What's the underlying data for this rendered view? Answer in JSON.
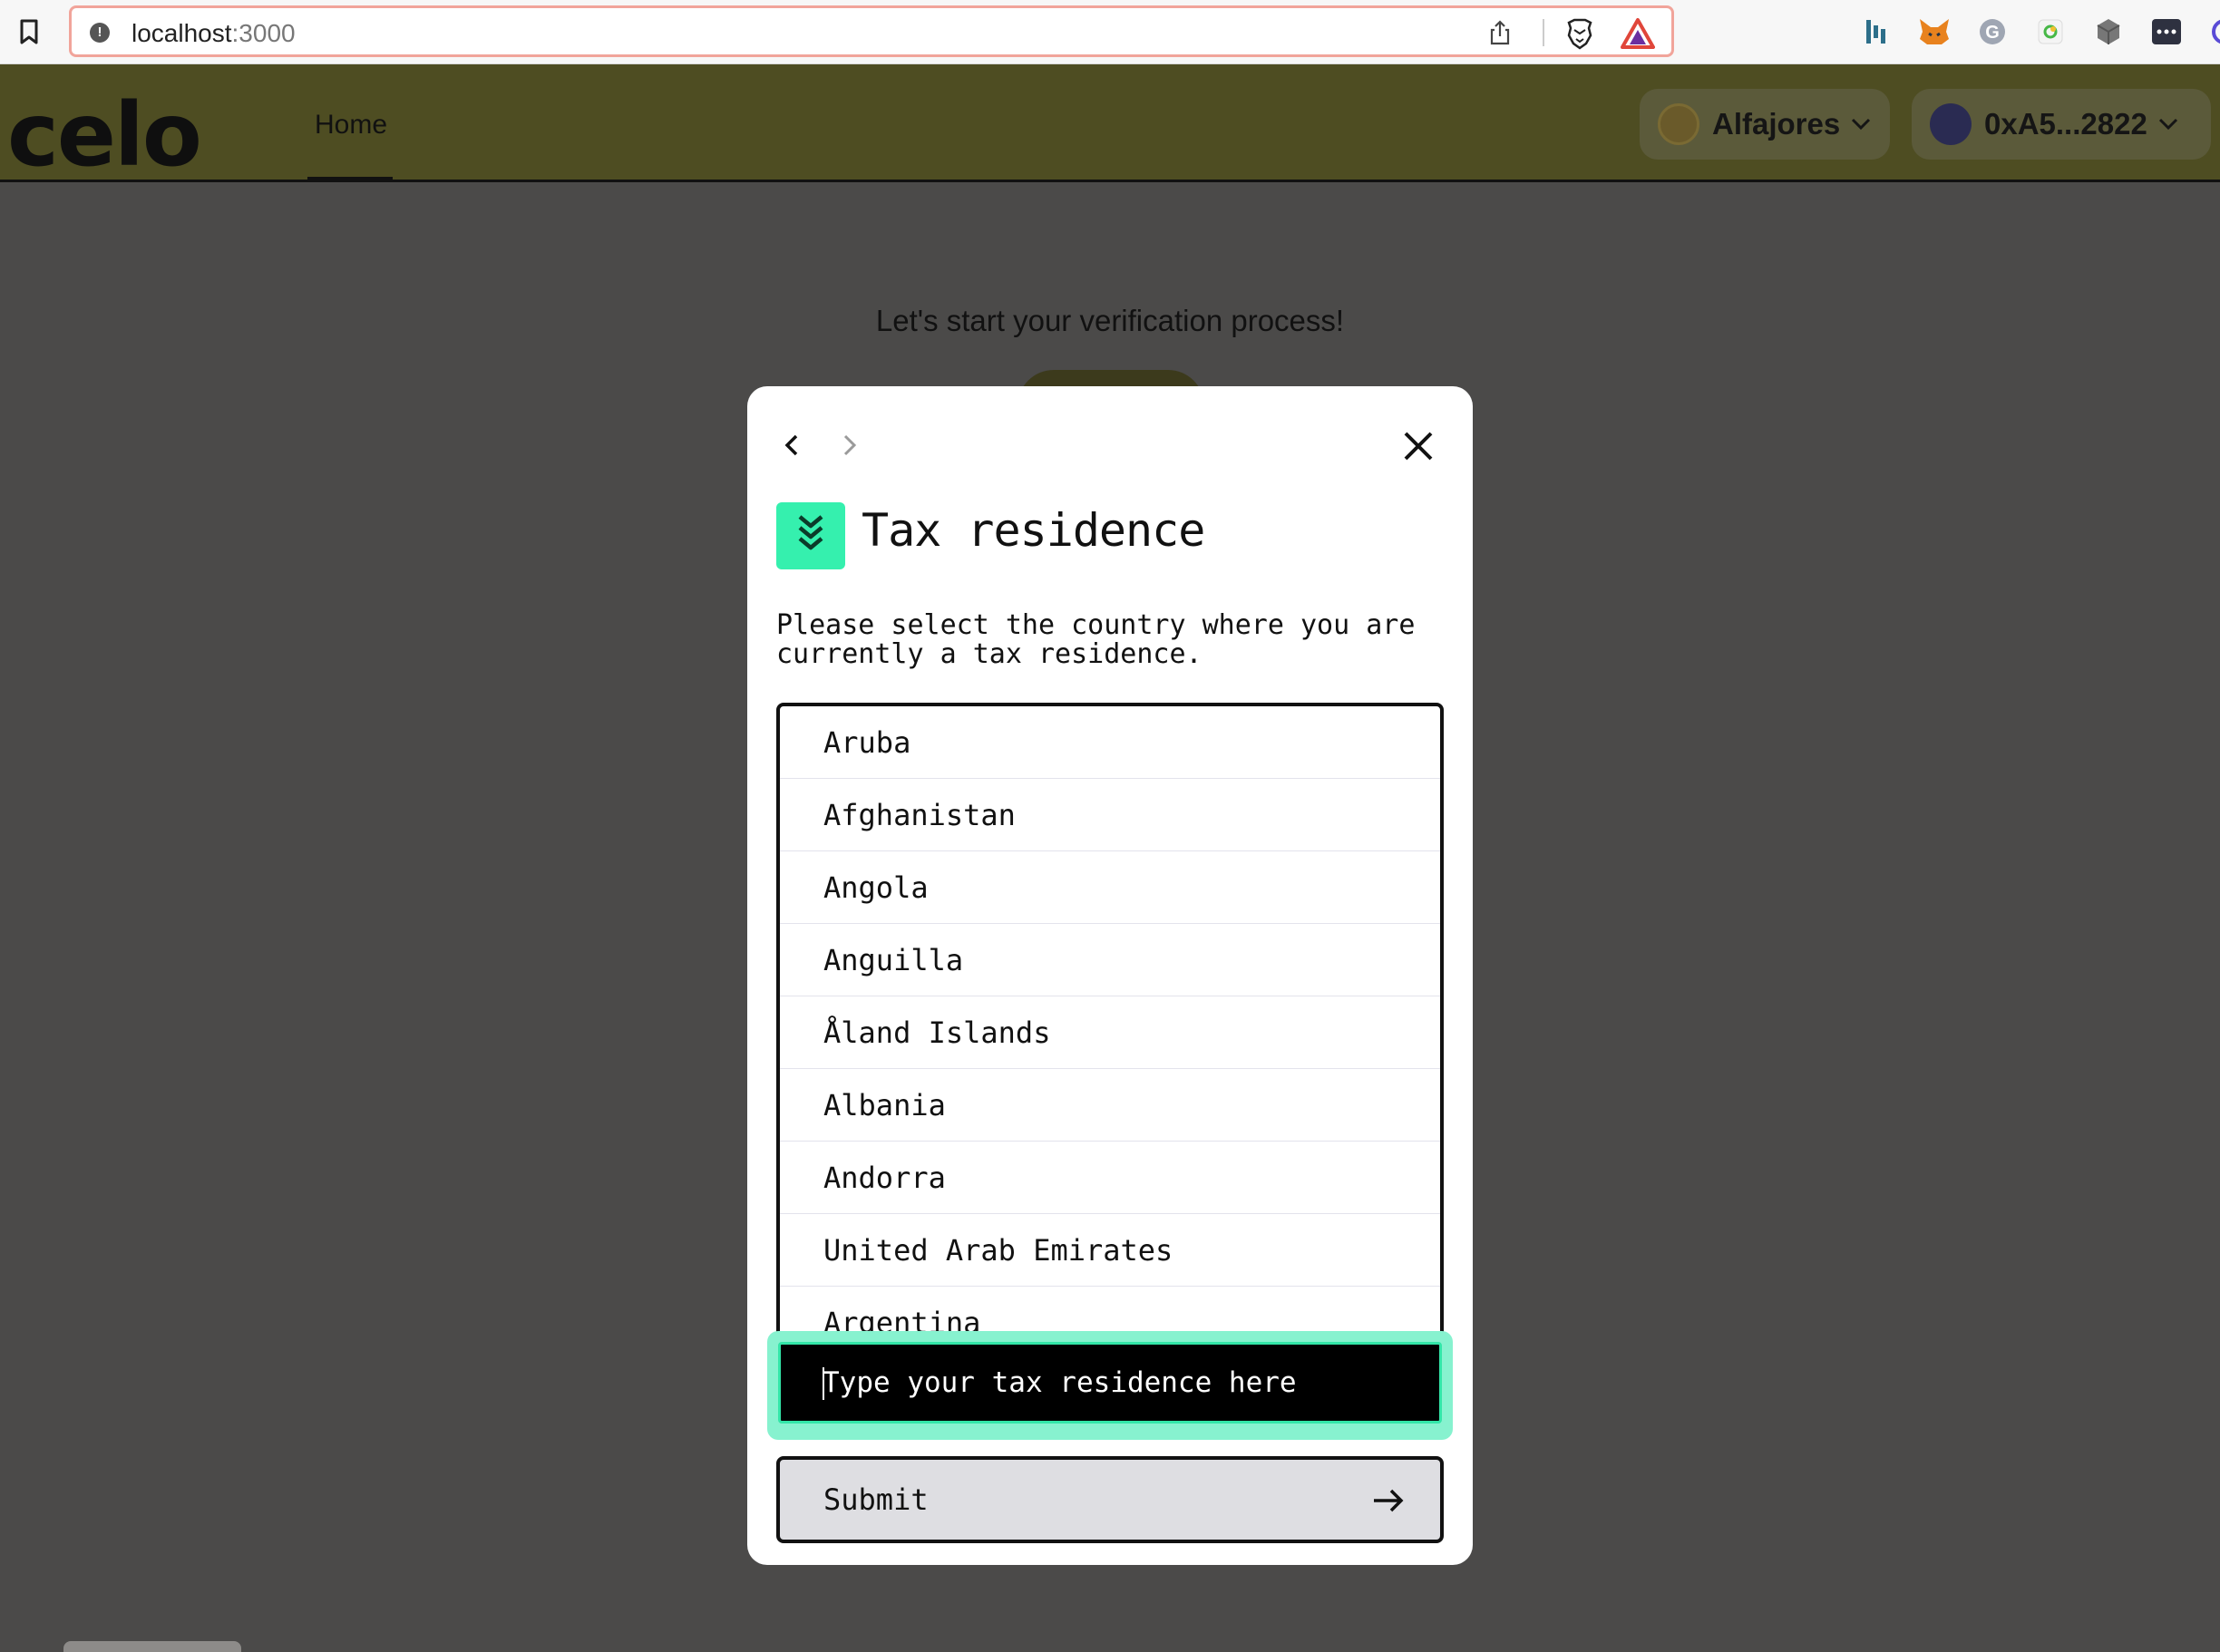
{
  "browser": {
    "url_host": "localhost",
    "url_port": ":3000"
  },
  "header": {
    "logo": "celo",
    "nav_home": "Home",
    "network_label": "Alfajores",
    "wallet_label": "0xA5...2822"
  },
  "background": {
    "title": "Let's start your verification process!"
  },
  "modal": {
    "title": "Tax residence",
    "description": "Please select the country where you are currently a tax residence.",
    "countries": [
      "Aruba",
      "Afghanistan",
      "Angola",
      "Anguilla",
      "Åland Islands",
      "Albania",
      "Andorra",
      "United Arab Emirates",
      "Argentina"
    ],
    "input_placeholder": "Type your tax residence here",
    "submit_label": "Submit"
  },
  "colors": {
    "accent": "#35f0ae",
    "header_bg": "#4e4d22",
    "overlay_bg": "#4b4a49"
  }
}
